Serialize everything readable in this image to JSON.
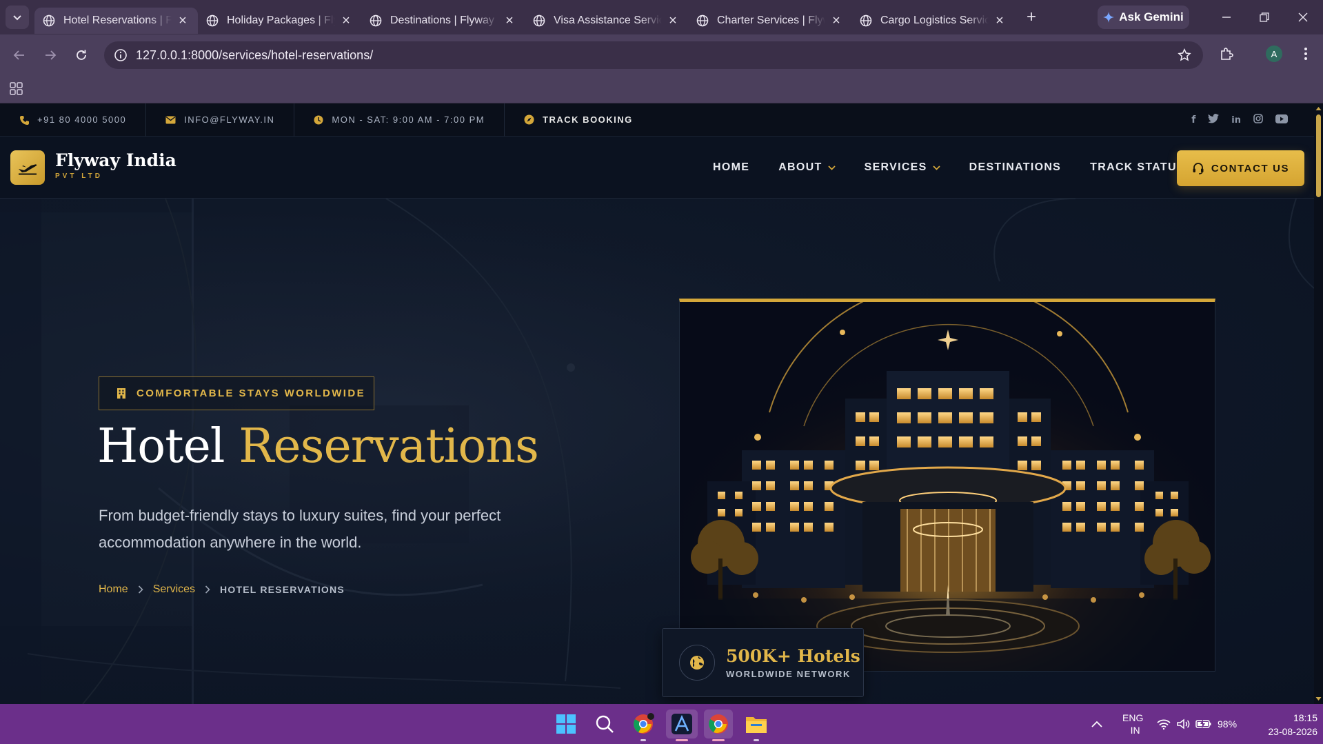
{
  "browser": {
    "tabs": [
      {
        "title": "Hotel Reservations | Flyway India",
        "active": true
      },
      {
        "title": "Holiday Packages | Flyway India",
        "active": false
      },
      {
        "title": "Destinations | Flyway India",
        "active": false
      },
      {
        "title": "Visa Assistance Services | Flyway India",
        "active": false
      },
      {
        "title": "Charter Services | Flyway India",
        "active": false
      },
      {
        "title": "Cargo Logistics Services | Flyway India",
        "active": false
      }
    ],
    "gemini_label": "Ask Gemini",
    "url": "127.0.0.1:8000/services/hotel-reservations/",
    "profile_initial": "A"
  },
  "topbar": {
    "phone": "+91 80 4000 5000",
    "email": "INFO@FLYWAY.IN",
    "hours": "MON - SAT: 9:00 AM - 7:00 PM",
    "track": "TRACK BOOKING",
    "socials": [
      "facebook-icon",
      "twitter-icon",
      "linkedin-icon",
      "instagram-icon",
      "youtube-icon"
    ]
  },
  "header": {
    "brand_name": "Flyway India",
    "brand_sub": "PVT LTD",
    "nav": [
      {
        "label": "HOME",
        "dropdown": false
      },
      {
        "label": "ABOUT",
        "dropdown": true
      },
      {
        "label": "SERVICES",
        "dropdown": true
      },
      {
        "label": "DESTINATIONS",
        "dropdown": false
      },
      {
        "label": "TRACK STATUS",
        "dropdown": false
      }
    ],
    "cta": "CONTACT US"
  },
  "hero": {
    "eyebrow": "COMFORTABLE STAYS WORLDWIDE",
    "title_part1": "Hotel",
    "title_part2": "Reservations",
    "description": "From budget-friendly stays to luxury suites, find your perfect accommodation anywhere in the world.",
    "breadcrumb": {
      "home": "Home",
      "services": "Services",
      "current": "HOTEL RESERVATIONS"
    },
    "stat_number": "500K+ Hotels",
    "stat_label": "WORLDWIDE NETWORK"
  },
  "taskbar": {
    "lang_top": "ENG",
    "lang_bottom": "IN",
    "battery": "98%",
    "time": "18:15",
    "date": "23-08-2026"
  },
  "colors": {
    "gold": "#e2b74a",
    "taskbar": "#6b2f8a",
    "chrome": "#4b3f5c",
    "site_bg": "#0b1220"
  }
}
